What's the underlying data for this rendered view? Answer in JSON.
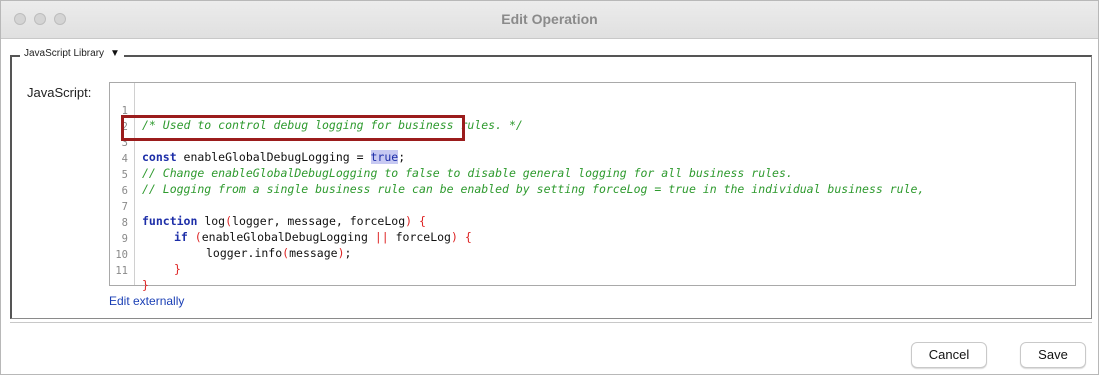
{
  "window": {
    "title": "Edit Operation"
  },
  "library_dropdown": {
    "label": "JavaScript Library"
  },
  "editor_label": "JavaScript:",
  "code_lines": [
    {
      "num": "1",
      "text": "/* Used to control debug logging for business rules. */"
    },
    {
      "num": "2",
      "text": ""
    },
    {
      "num": "3",
      "text": "const enableGlobalDebugLogging = true;"
    },
    {
      "num": "4",
      "text": "// Change enableGlobalDebugLogging to false to disable general logging for all business rules."
    },
    {
      "num": "5",
      "text": "// Logging from a single business rule can be enabled by setting forceLog = true in the individual business rule,"
    },
    {
      "num": "6",
      "text": ""
    },
    {
      "num": "7",
      "text": "function log(logger, message, forceLog) {"
    },
    {
      "num": "8",
      "text": "if (enableGlobalDebugLogging || forceLog) {"
    },
    {
      "num": "9",
      "text": "logger.info(message);"
    },
    {
      "num": "10",
      "text": "}"
    },
    {
      "num": "11",
      "text": "}"
    }
  ],
  "code_tokens": {
    "l3_kw": "const",
    "l3_id": " enableGlobalDebugLogging = ",
    "l3_bool": "true",
    "l3_end": ";",
    "l7_kw": "function",
    "l7_id": " log",
    "l7_open": "(",
    "l7_args": "logger, message, forceLog",
    "l7_close": ")",
    "l7_brace": " {",
    "l8_kw": "if",
    "l8_open": " (",
    "l8_a": "enableGlobalDebugLogging",
    "l8_or": " || ",
    "l8_b": "forceLog",
    "l8_close": ")",
    "l8_brace": " {",
    "l9_a": "logger.info",
    "l9_open": "(",
    "l9_b": "message",
    "l9_close": ")",
    "l9_end": ";",
    "l10": "}",
    "l11": "}"
  },
  "edit_externally": "Edit externally",
  "buttons": {
    "cancel": "Cancel",
    "save": "Save"
  },
  "colors": {
    "comment": "#2e9a2e",
    "keyword": "#1d2ea8",
    "bracket": "#dd2222",
    "highlight_box": "#9b1c1c",
    "link": "#1a3fb5"
  }
}
